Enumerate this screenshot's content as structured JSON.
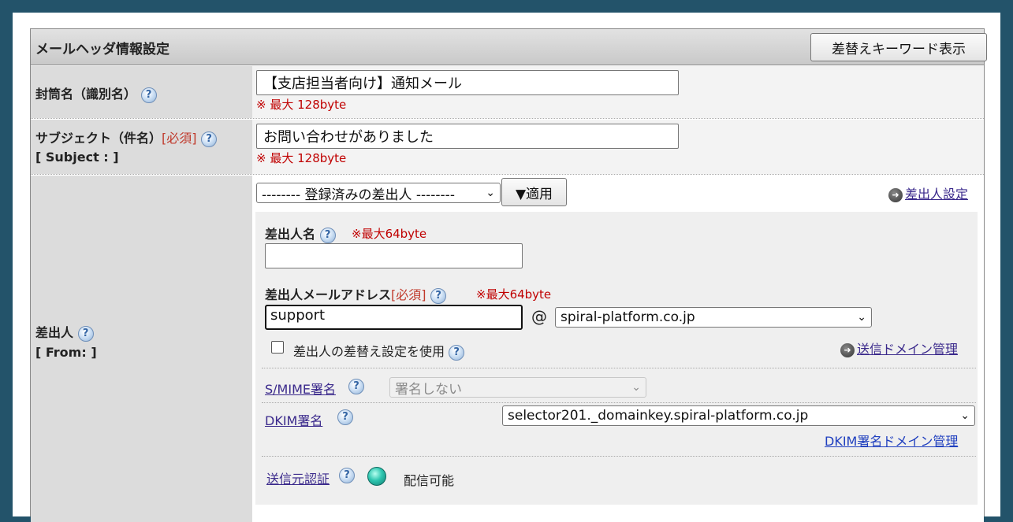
{
  "header": {
    "title": "メールヘッダ情報設定",
    "replace_keyword_button": "差替えキーワード表示"
  },
  "envelope": {
    "label": "封筒名（識別名）",
    "value": "【支店担当者向け】通知メール",
    "note": "※ 最大 128byte"
  },
  "subject": {
    "label": "サブジェクト（件名）",
    "required": "[必須]",
    "sublabel": "[ Subject : ]",
    "value": "お問い合わせがありました",
    "note": "※ 最大 128byte"
  },
  "from": {
    "label": "差出人",
    "sublabel": "[ From: ]",
    "registered_select": "-------- 登録済みの差出人 --------",
    "apply_button": "▼適用",
    "sender_settings_link": "差出人設定",
    "sender_name_label": "差出人名",
    "sender_name_note": "※最大64byte",
    "sender_name_value": "",
    "sender_address_label": "差出人メールアドレス",
    "sender_address_required": "[必須]",
    "sender_address_note": "※最大64byte",
    "sender_address_local": "support",
    "at_sign": "@",
    "sender_domain": "spiral-platform.co.jp",
    "use_replace_label": "差出人の差替え設定を使用",
    "domain_mgmt_link": "送信ドメイン管理",
    "smime_link": "S/MIME署名",
    "smime_select": "署名しない",
    "dkim_link": "DKIM署名",
    "dkim_select": "selector201._domainkey.spiral-platform.co.jp",
    "dkim_domain_link": "DKIM署名ドメイン管理",
    "auth_link": "送信元認証",
    "auth_status": "配信可能",
    "help_glyph": "?",
    "arrow_glyph": "➜",
    "chevron_glyph": "⌄"
  }
}
